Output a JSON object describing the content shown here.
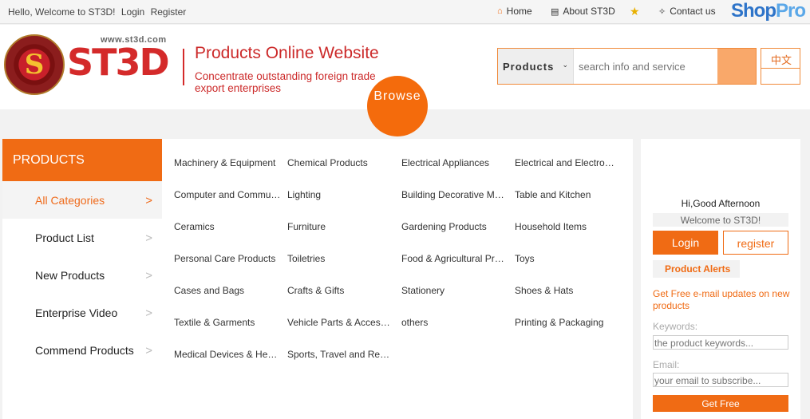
{
  "topbar": {
    "welcome": "Hello, Welcome to ST3D!",
    "login": "Login",
    "register": "Register",
    "nav": [
      {
        "label": "Home",
        "icon": "home-icon"
      },
      {
        "label": "About ST3D",
        "icon": "book-icon"
      },
      {
        "label": "",
        "icon": "star-icon"
      },
      {
        "label": "Contact us",
        "icon": "contact-icon"
      }
    ],
    "brand_a": "Shop",
    "brand_b": "Pro"
  },
  "header": {
    "logo_url": "www.st3d.com",
    "logo_text": "ST3D",
    "site_title": "Products Online Website",
    "tagline_1": "Concentrate outstanding foreign trade",
    "tagline_2": "export enterprises"
  },
  "search": {
    "category": "Products",
    "placeholder": "search info and service",
    "lang": "中文"
  },
  "browse": "Browse",
  "leftnav": {
    "title": "PRODUCTS",
    "items": [
      {
        "label": "All Categories",
        "active": true
      },
      {
        "label": "Product List"
      },
      {
        "label": "New Products"
      },
      {
        "label": "Enterprise Video"
      },
      {
        "label": "Commend Products"
      }
    ],
    "arrow": ">"
  },
  "categories": [
    [
      "Machinery & Equipment",
      "Chemical Products",
      "Electrical Appliances",
      "Electrical and Electronic"
    ],
    [
      "Computer and Communication",
      "Lighting",
      "Building Decorative Materials",
      "Table and Kitchen"
    ],
    [
      "Ceramics",
      "Furniture",
      "Gardening Products",
      "Household Items"
    ],
    [
      "Personal Care Products",
      "Toiletries",
      "Food & Agricultural Products",
      "Toys"
    ],
    [
      "Cases and Bags",
      "Crafts & Gifts",
      "Stationery",
      "Shoes & Hats"
    ],
    [
      "Textile & Garments",
      "Vehicle Parts & Accessories",
      "others",
      "Printing & Packaging"
    ],
    [
      "Medical Devices & Health",
      "Sports, Travel and Recreation",
      "",
      ""
    ]
  ],
  "rpanel": {
    "greeting": "Hi,Good Afternoon",
    "welcome": "Welcome to ST3D!",
    "login": "Login",
    "register": "register",
    "alerts_title": "Product Alerts",
    "desc": "Get Free e-mail updates on new products",
    "keywords_label": "Keywords:",
    "keywords_placeholder": "the product keywords...",
    "email_label": "Email:",
    "email_placeholder": "your email to subscribe...",
    "submit": "Get Free"
  },
  "colors": {
    "accent": "#f06b14",
    "brand_red": "#d42a2a",
    "brand_blue": "#2e74c9"
  }
}
